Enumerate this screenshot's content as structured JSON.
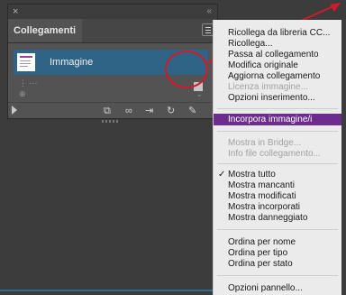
{
  "panel": {
    "close_glyph": "×",
    "collapse_glyph": "«",
    "tab_label": "Collegamenti",
    "row_label": "Immagine",
    "info_glyph_1": "⋮ ···",
    "info_glyph_2": "⊕"
  },
  "toolbar_icons": [
    "relink-from-cc-icon",
    "link-chain-icon",
    "goto-link-icon",
    "update-link-icon",
    "edit-original-icon"
  ],
  "menu": {
    "items": [
      {
        "label": "Ricollega da libreria CC...",
        "state": "normal"
      },
      {
        "label": "Ricollega...",
        "state": "normal"
      },
      {
        "label": "Passa al collegamento",
        "state": "normal"
      },
      {
        "label": "Modifica originale",
        "state": "normal"
      },
      {
        "label": "Aggiorna collegamento",
        "state": "normal"
      },
      {
        "label": "Licenza immagine...",
        "state": "disabled"
      },
      {
        "label": "Opzioni inserimento...",
        "state": "normal"
      },
      {
        "label": "Incorpora immagine/i",
        "state": "highlight"
      },
      {
        "label": "Mostra in Bridge...",
        "state": "disabled"
      },
      {
        "label": "Info file collegamento...",
        "state": "disabled"
      },
      {
        "label": "Mostra tutto",
        "state": "checked"
      },
      {
        "label": "Mostra mancanti",
        "state": "normal"
      },
      {
        "label": "Mostra modificati",
        "state": "normal"
      },
      {
        "label": "Mostra incorporati",
        "state": "normal"
      },
      {
        "label": "Mostra danneggiato",
        "state": "normal"
      },
      {
        "label": "Ordina per nome",
        "state": "normal"
      },
      {
        "label": "Ordina per tipo",
        "state": "normal"
      },
      {
        "label": "Ordina per stato",
        "state": "normal"
      },
      {
        "label": "Opzioni pannello...",
        "state": "normal"
      }
    ],
    "check_glyph": "✓"
  },
  "colors": {
    "highlight": "#6d2d8e",
    "selected_row": "#2f6487",
    "annotation_red": "#d11a2a"
  }
}
